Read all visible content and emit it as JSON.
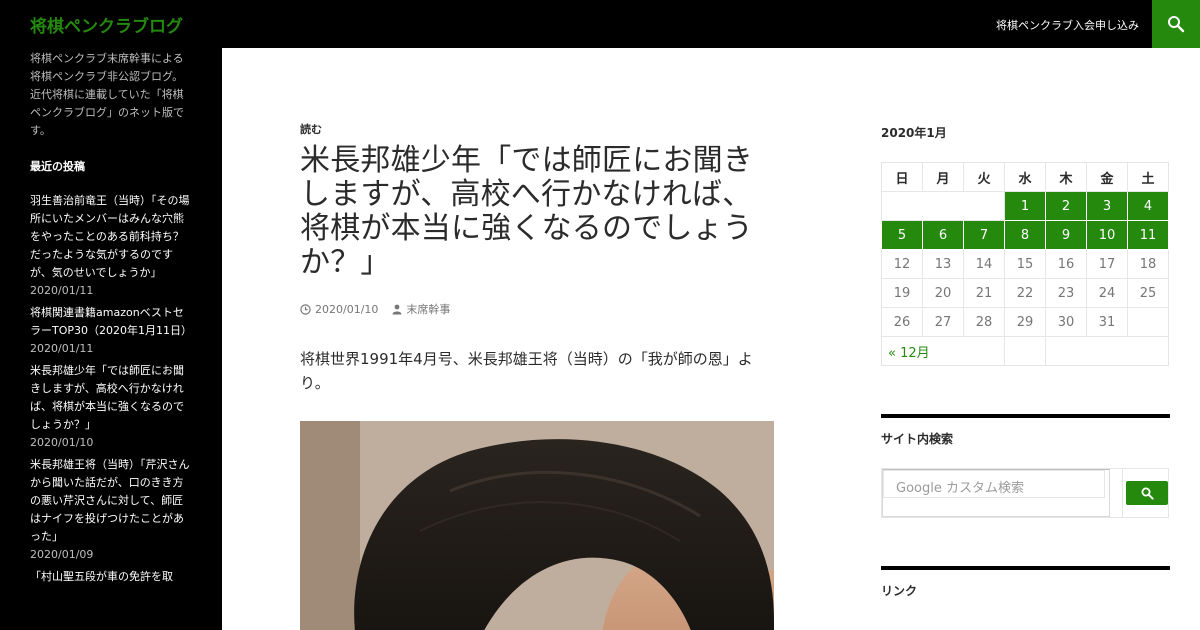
{
  "site": {
    "title": "将棋ペンクラブログ",
    "description": "将棋ペンクラブ末席幹事による将棋ペンクラブ非公認ブログ。近代将棋に連載していた「将棋ペンクラブログ」のネット版です。"
  },
  "nav": {
    "join_link": "将棋ペンクラブ入会申し込み",
    "search_icon": "search-icon"
  },
  "sidebar": {
    "recent_title": "最近の投稿",
    "recent_posts": [
      {
        "title": "羽生善治前竜王（当時）「その場所にいたメンバーはみんな穴熊をやったことのある前科持ち？だったような気がするのですが、気のせいでしょうか」",
        "date": "2020/01/11"
      },
      {
        "title": "将棋関連書籍amazonベストセラーTOP30（2020年1月11日）",
        "date": "2020/01/11"
      },
      {
        "title": "米長邦雄少年「では師匠にお聞きしますが、高校へ行かなければ、将棋が本当に強くなるのでしょうか？」",
        "date": "2020/01/10"
      },
      {
        "title": "米長邦雄王将（当時）「芹沢さんから聞いた話だが、口のきき方の悪い芹沢さんに対して、師匠はナイフを投げつけたことがあった」",
        "date": "2020/01/09"
      },
      {
        "title": "「村山聖五段が車の免許を取",
        "date": ""
      }
    ]
  },
  "post": {
    "category": "読む",
    "title": "米長邦雄少年「では師匠にお聞きしますが、高校へ行かなければ、将棋が本当に強くなるのでしょうか？」",
    "date": "2020/01/10",
    "author": "末席幹事",
    "excerpt": "将棋世界1991年4月号、米長邦雄王将（当時）の「我が師の恩」より。"
  },
  "calendar": {
    "caption": "2020年1月",
    "weekdays": [
      "日",
      "月",
      "火",
      "水",
      "木",
      "金",
      "土"
    ],
    "weeks": [
      [
        null,
        null,
        null,
        1,
        2,
        3,
        4
      ],
      [
        5,
        6,
        7,
        8,
        9,
        10,
        11
      ],
      [
        12,
        13,
        14,
        15,
        16,
        17,
        18
      ],
      [
        19,
        20,
        21,
        22,
        23,
        24,
        25
      ],
      [
        26,
        27,
        28,
        29,
        30,
        31,
        null
      ]
    ],
    "linked_days": [
      1,
      2,
      3,
      4,
      5,
      6,
      7,
      8,
      9,
      10,
      11
    ],
    "prev_link": "« 12月",
    "accent": "#24890d"
  },
  "widgets": {
    "search_title": "サイト内検索",
    "search_placeholder": "Google カスタム検索",
    "links_title": "リンク"
  }
}
